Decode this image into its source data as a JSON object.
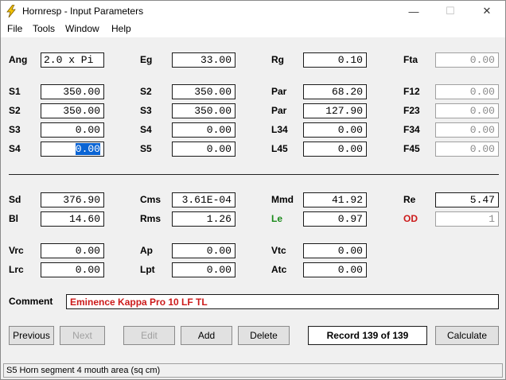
{
  "window": {
    "title": "Hornresp - Input Parameters",
    "controls": {
      "minimize": "—",
      "maximize": "☐",
      "close": "✕"
    }
  },
  "menu": [
    "File",
    "Tools",
    "Window",
    "Help"
  ],
  "fields": {
    "Ang": "2.0 x Pi",
    "Eg": "33.00",
    "Rg": "0.10",
    "Fta": "0.00",
    "S1": "350.00",
    "S2a": "350.00",
    "Par1": "68.20",
    "F12": "0.00",
    "S2": "350.00",
    "S3a": "350.00",
    "Par2": "127.90",
    "F23": "0.00",
    "S3": "0.00",
    "S4a": "0.00",
    "L34": "0.00",
    "F34": "0.00",
    "S4": "0.00",
    "S5": "0.00",
    "L45": "0.00",
    "F45": "0.00",
    "Sd": "376.90",
    "Cms": "3.61E-04",
    "Mmd": "41.92",
    "Re": "5.47",
    "Bl": "14.60",
    "Rms": "1.26",
    "Le": "0.97",
    "OD": "1",
    "Vrc": "0.00",
    "Ap": "0.00",
    "Vtc": "0.00",
    "Lrc": "0.00",
    "Lpt": "0.00",
    "Atc": "0.00"
  },
  "labels": {
    "Ang": "Ang",
    "Eg": "Eg",
    "Rg": "Rg",
    "Fta": "Fta",
    "S1": "S1",
    "S2a": "S2",
    "Par1": "Par",
    "F12": "F12",
    "S2": "S2",
    "S3a": "S3",
    "Par2": "Par",
    "F23": "F23",
    "S3": "S3",
    "S4a": "S4",
    "L34": "L34",
    "F34": "F34",
    "S4": "S4",
    "S5": "S5",
    "L45": "L45",
    "F45": "F45",
    "Sd": "Sd",
    "Cms": "Cms",
    "Mmd": "Mmd",
    "Re": "Re",
    "Bl": "Bl",
    "Rms": "Rms",
    "Le": "Le",
    "OD": "OD",
    "Vrc": "Vrc",
    "Ap": "Ap",
    "Vtc": "Vtc",
    "Lrc": "Lrc",
    "Lpt": "Lpt",
    "Atc": "Atc",
    "Comment": "Comment"
  },
  "comment": "Eminence Kappa Pro 10 LF TL",
  "buttons": {
    "previous": "Previous",
    "next": "Next",
    "edit": "Edit",
    "add": "Add",
    "delete": "Delete",
    "calculate": "Calculate"
  },
  "record": "Record 139 of 139",
  "status": "S5   Horn segment 4 mouth area  (sq cm)",
  "colors": {
    "accent_red": "#cc1a1a",
    "accent_green": "#1a8a1a",
    "selection": "#0a64d4"
  }
}
